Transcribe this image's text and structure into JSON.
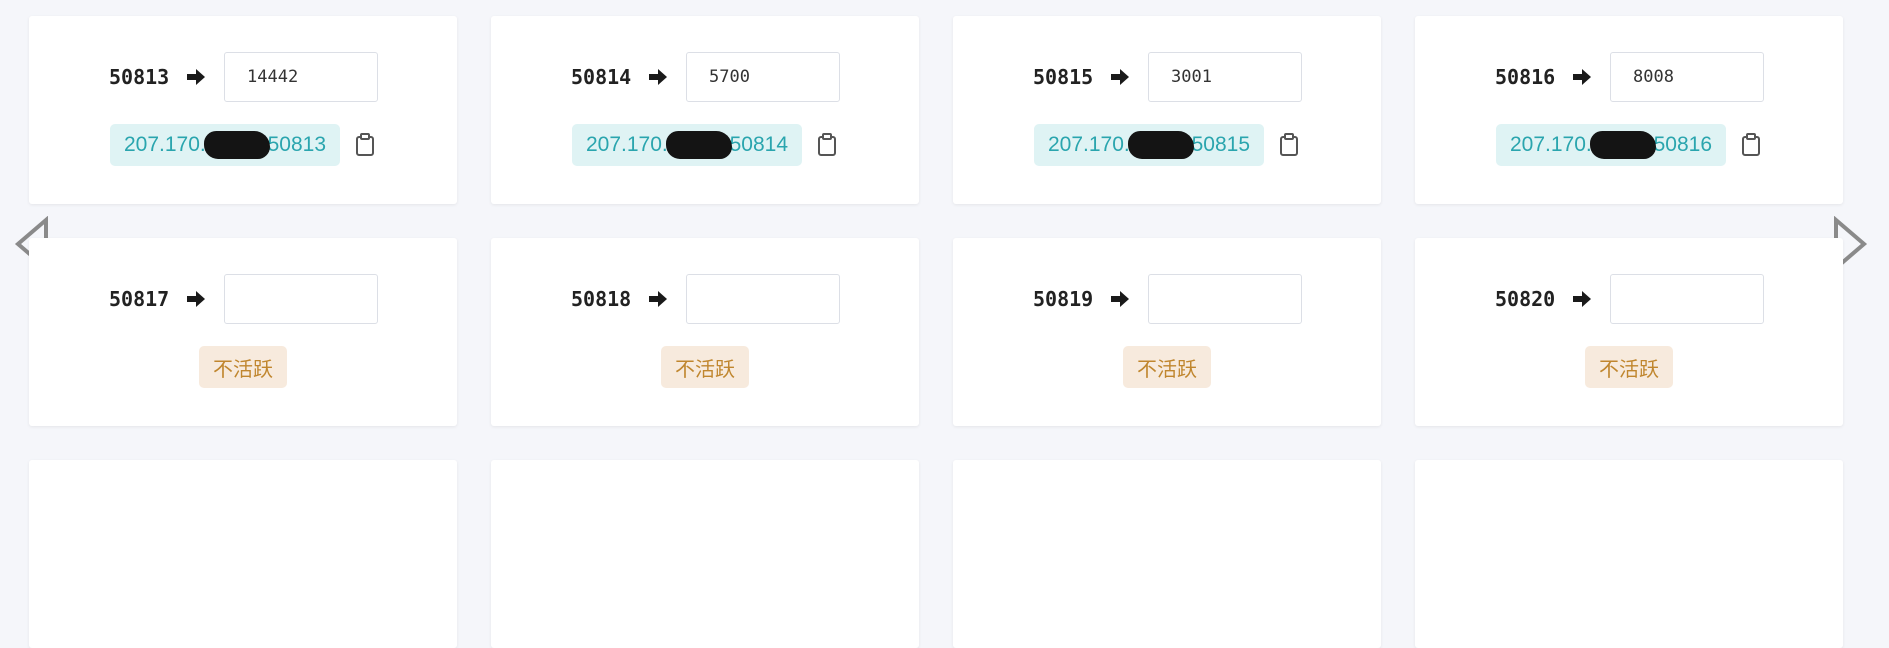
{
  "cards": [
    {
      "port": "50813",
      "target": "14442",
      "addr_prefix": "207.170.",
      "addr_suffix": ":50813",
      "status": ""
    },
    {
      "port": "50814",
      "target": "5700",
      "addr_prefix": "207.170.",
      "addr_suffix": ":50814",
      "status": ""
    },
    {
      "port": "50815",
      "target": "3001",
      "addr_prefix": "207.170.",
      "addr_suffix": ":50815",
      "status": ""
    },
    {
      "port": "50816",
      "target": "8008",
      "addr_prefix": "207.170.",
      "addr_suffix": ":50816",
      "status": ""
    },
    {
      "port": "50817",
      "target": "",
      "status": "不活跃"
    },
    {
      "port": "50818",
      "target": "",
      "status": "不活跃"
    },
    {
      "port": "50819",
      "target": "",
      "status": "不活跃"
    },
    {
      "port": "50820",
      "target": "",
      "status": "不活跃"
    }
  ],
  "icons": {
    "arrow": "arrow-right-icon",
    "copy": "clipboard-icon",
    "prev": "chevron-left-icon",
    "next": "chevron-right-icon"
  },
  "colors": {
    "background": "#f5f6fa",
    "address_badge_bg": "#dff3f4",
    "address_text": "#2aa5ae",
    "inactive_bg": "#f7eadd",
    "inactive_text": "#c0862e"
  }
}
